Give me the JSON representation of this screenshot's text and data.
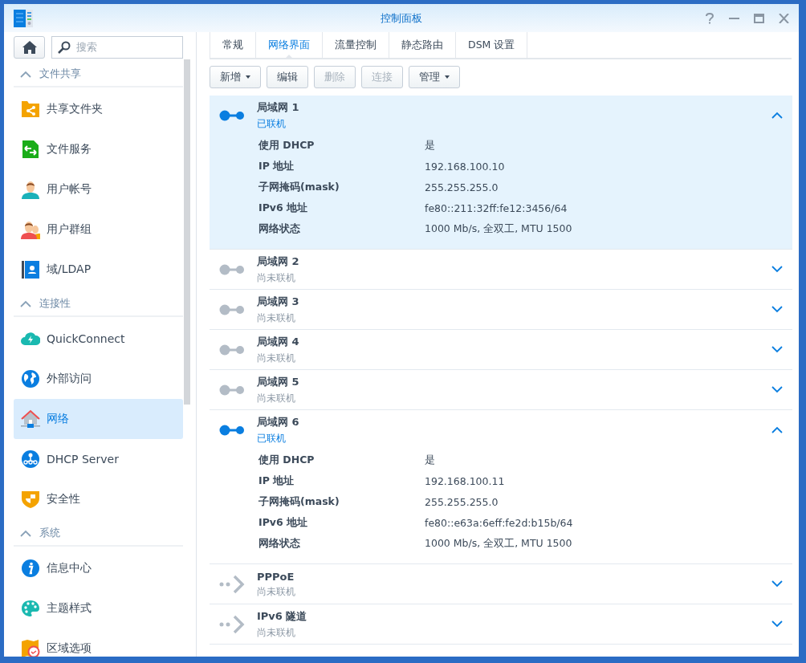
{
  "window": {
    "title": "控制面板"
  },
  "sidebar": {
    "search": {
      "placeholder": "搜索"
    },
    "groups": [
      {
        "label": "文件共享",
        "expanded": true,
        "items": [
          {
            "label": "共享文件夹",
            "kind": "share-folder",
            "selected": false
          },
          {
            "label": "文件服务",
            "kind": "file-service",
            "selected": false
          },
          {
            "label": "用户帐号",
            "kind": "user",
            "selected": false
          },
          {
            "label": "用户群组",
            "kind": "group",
            "selected": false
          },
          {
            "label": "域/LDAP",
            "kind": "ldap",
            "selected": false
          }
        ]
      },
      {
        "label": "连接性",
        "expanded": true,
        "items": [
          {
            "label": "QuickConnect",
            "kind": "cloud",
            "selected": false
          },
          {
            "label": "外部访问",
            "kind": "globe",
            "selected": false
          },
          {
            "label": "网络",
            "kind": "network",
            "selected": true
          },
          {
            "label": "DHCP Server",
            "kind": "dhcp",
            "selected": false
          },
          {
            "label": "安全性",
            "kind": "shield",
            "selected": false
          }
        ]
      },
      {
        "label": "系统",
        "expanded": true,
        "items": [
          {
            "label": "信息中心",
            "kind": "info",
            "selected": false
          },
          {
            "label": "主题样式",
            "kind": "palette",
            "selected": false
          },
          {
            "label": "区域选项",
            "kind": "region",
            "selected": false
          }
        ]
      }
    ]
  },
  "tabs": [
    {
      "label": "常规",
      "selected": false
    },
    {
      "label": "网络界面",
      "selected": true
    },
    {
      "label": "流量控制",
      "selected": false
    },
    {
      "label": "静态路由",
      "selected": false
    },
    {
      "label": "DSM 设置",
      "selected": false
    }
  ],
  "toolbar": [
    {
      "label": "新增",
      "disabled": false,
      "dropdown": true
    },
    {
      "label": "编辑",
      "disabled": false,
      "dropdown": false
    },
    {
      "label": "删除",
      "disabled": true,
      "dropdown": false
    },
    {
      "label": "连接",
      "disabled": true,
      "dropdown": false
    },
    {
      "label": "管理",
      "disabled": false,
      "dropdown": true
    }
  ],
  "interfaces": [
    {
      "name": "局域网 1",
      "kind": "lan",
      "status": "已联机",
      "connected": true,
      "expanded": true,
      "selected": true,
      "details": [
        {
          "label": "使用 DHCP",
          "value": "是"
        },
        {
          "label": "IP 地址",
          "value": "192.168.100.10"
        },
        {
          "label": "子网掩码(mask)",
          "value": "255.255.255.0"
        },
        {
          "label": "IPv6 地址",
          "value": "fe80::211:32ff:fe12:3456/64"
        },
        {
          "label": "网络状态",
          "value": "1000 Mb/s, 全双工, MTU 1500"
        }
      ]
    },
    {
      "name": "局域网 2",
      "kind": "lan",
      "status": "尚未联机",
      "connected": false,
      "expanded": false,
      "selected": false
    },
    {
      "name": "局域网 3",
      "kind": "lan",
      "status": "尚未联机",
      "connected": false,
      "expanded": false,
      "selected": false
    },
    {
      "name": "局域网 4",
      "kind": "lan",
      "status": "尚未联机",
      "connected": false,
      "expanded": false,
      "selected": false
    },
    {
      "name": "局域网 5",
      "kind": "lan",
      "status": "尚未联机",
      "connected": false,
      "expanded": false,
      "selected": false
    },
    {
      "name": "局域网 6",
      "kind": "lan",
      "status": "已联机",
      "connected": true,
      "expanded": true,
      "selected": false,
      "details": [
        {
          "label": "使用 DHCP",
          "value": "是"
        },
        {
          "label": "IP 地址",
          "value": "192.168.100.11"
        },
        {
          "label": "子网掩码(mask)",
          "value": "255.255.255.0"
        },
        {
          "label": "IPv6 地址",
          "value": "fe80::e63a:6eff:fe2d:b15b/64"
        },
        {
          "label": "网络状态",
          "value": "1000 Mb/s, 全双工, MTU 1500"
        }
      ]
    },
    {
      "name": "PPPoE",
      "kind": "tunnel",
      "status": "尚未联机",
      "connected": false,
      "expanded": false,
      "selected": false
    },
    {
      "name": "IPv6 隧道",
      "kind": "tunnel",
      "status": "尚未联机",
      "connected": false,
      "expanded": false,
      "selected": false
    }
  ]
}
